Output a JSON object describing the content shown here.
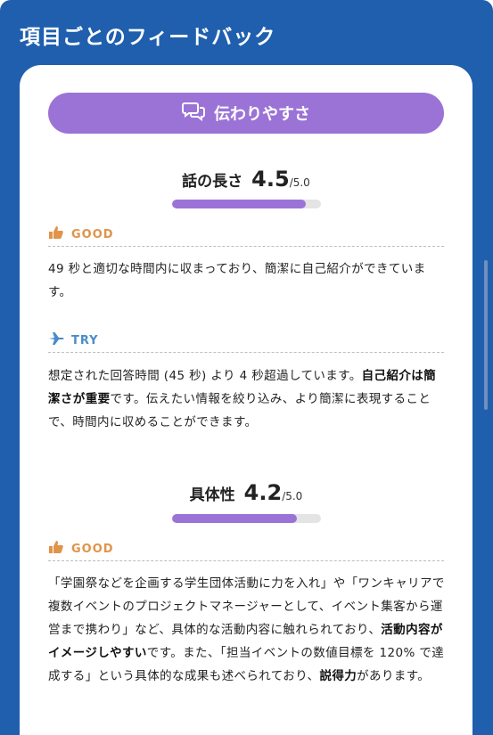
{
  "header": {
    "title": "項目ごとのフィードバック"
  },
  "category": {
    "label": "伝わりやすさ",
    "icon": "chat-bubbles-icon",
    "color": "#9b73d6"
  },
  "sections": [
    {
      "name": "話の長さ",
      "score": "4.5",
      "max": "/5.0",
      "level": 0.9,
      "good": {
        "label": "GOOD",
        "icon": "thumbs-up-icon",
        "text": "49 秒と適切な時間内に収まっており、簡潔に自己紹介ができています。"
      },
      "try": {
        "label": "TRY",
        "icon": "airplane-icon",
        "text_1": "想定された回答時間 (45 秒) より 4 秒超過しています。",
        "bold_1": "自己紹介は簡潔さが重要",
        "text_2": "です。伝えたい情報を絞り込み、より簡潔に表現することで、時間内に収めることができます。"
      }
    },
    {
      "name": "具体性",
      "score": "4.2",
      "max": "/5.0",
      "level": 0.84,
      "good": {
        "label": "GOOD",
        "icon": "thumbs-up-icon",
        "text_1": "「学園祭などを企画する学生団体活動に力を入れ」や「ワンキャリアで複数イベントのプロジェクトマネージャーとして、イベント集客から運営まで携わり」など、具体的な活動内容に触れられており、",
        "bold_1": "活動内容がイメージしやすい",
        "text_2": "です。また、「担当イベントの数値目標を 120% で達成する」という具体的な成果も述べられており、",
        "bold_2": "説得力",
        "text_3": "があります。"
      }
    }
  ],
  "colors": {
    "brand": "#1f5fae",
    "good": "#e0944a",
    "try": "#4a8cc9",
    "bar_track": "#e4e4e4"
  }
}
